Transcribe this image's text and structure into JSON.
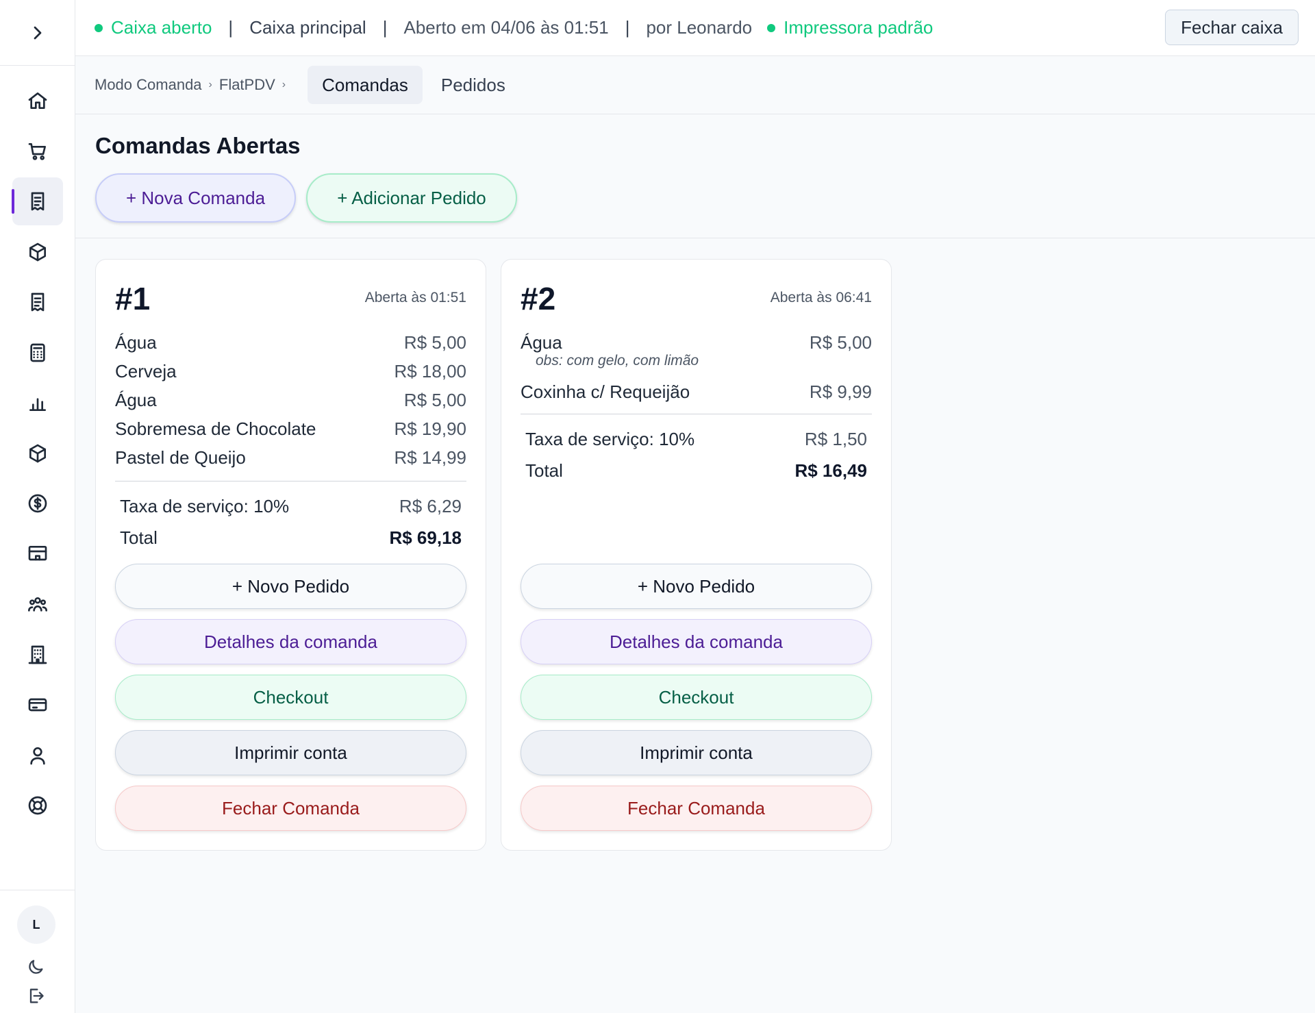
{
  "topbar": {
    "cash_status": "Caixa aberto",
    "separator": "|",
    "register_name": "Caixa principal",
    "opened_at": "Aberto em 04/06 às 01:51",
    "opened_by": "por Leonardo",
    "printer_status": "Impressora padrão",
    "close_cash_label": "Fechar caixa"
  },
  "breadcrumb": {
    "items": [
      "Modo Comanda",
      "FlatPDV"
    ],
    "separator": "›"
  },
  "tabs": [
    {
      "label": "Comandas",
      "active": true
    },
    {
      "label": "Pedidos",
      "active": false
    }
  ],
  "page": {
    "title": "Comandas Abertas",
    "new_order_tab_label": "+ Nova Comanda",
    "add_order_label": "+ Adicionar Pedido"
  },
  "sidebar": {
    "expand_icon": "chevron-right-icon",
    "items": [
      {
        "icon": "home-icon",
        "active": false
      },
      {
        "icon": "cart-icon",
        "active": false
      },
      {
        "icon": "receipt-icon",
        "active": true
      },
      {
        "icon": "box-icon",
        "active": false
      },
      {
        "icon": "receipt-icon",
        "active": false
      },
      {
        "icon": "calculator-icon",
        "active": false
      },
      {
        "icon": "bar-chart-icon",
        "active": false
      },
      {
        "icon": "box-icon",
        "active": false
      },
      {
        "icon": "dollar-circle-icon",
        "active": false
      },
      {
        "icon": "store-icon",
        "active": false
      },
      {
        "icon": "users-icon",
        "active": false
      },
      {
        "icon": "building-icon",
        "active": false
      },
      {
        "icon": "card-icon",
        "active": false
      },
      {
        "icon": "user-icon",
        "active": false
      },
      {
        "icon": "lifebuoy-icon",
        "active": false
      }
    ],
    "avatar_initial": "L"
  },
  "cards": [
    {
      "number": "#1",
      "opened": "Aberta às 01:51",
      "items": [
        {
          "name": "Água",
          "price": "R$ 5,00"
        },
        {
          "name": "Cerveja",
          "price": "R$ 18,00"
        },
        {
          "name": "Água",
          "price": "R$ 5,00"
        },
        {
          "name": "Sobremesa de Chocolate",
          "price": "R$ 19,90"
        },
        {
          "name": "Pastel de Queijo",
          "price": "R$ 14,99"
        }
      ],
      "service_label": "Taxa de serviço: 10%",
      "service_value": "R$ 6,29",
      "total_label": "Total",
      "total_value": "R$ 69,18",
      "buttons": {
        "new_order": "+ Novo Pedido",
        "details": "Detalhes da comanda",
        "checkout": "Checkout",
        "print": "Imprimir conta",
        "close": "Fechar Comanda"
      }
    },
    {
      "number": "#2",
      "opened": "Aberta às 06:41",
      "items": [
        {
          "name": "Água",
          "price": "R$ 5,00",
          "obs": "obs: com gelo, com limão"
        },
        {
          "name": "Coxinha c/ Requeijão",
          "price": "R$ 9,99"
        }
      ],
      "service_label": "Taxa de serviço: 10%",
      "service_value": "R$ 1,50",
      "total_label": "Total",
      "total_value": "R$ 16,49",
      "buttons": {
        "new_order": "+ Novo Pedido",
        "details": "Detalhes da comanda",
        "checkout": "Checkout",
        "print": "Imprimir conta",
        "close": "Fechar Comanda"
      }
    }
  ],
  "colors": {
    "status_green": "#10c97e",
    "accent_purple": "#6d28d9",
    "danger_red": "#991b1b"
  }
}
